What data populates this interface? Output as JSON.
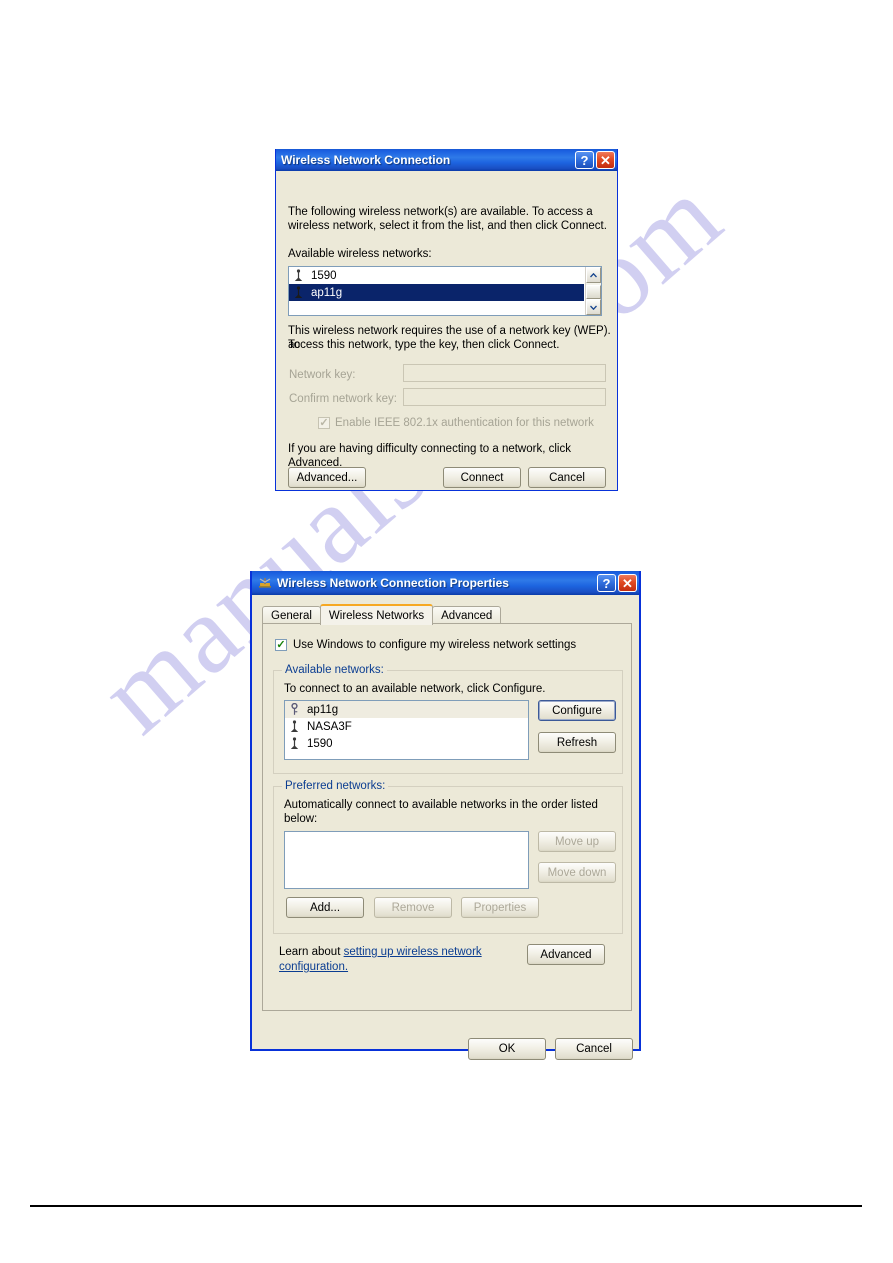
{
  "page": {
    "watermark_text": "manualsave.com"
  },
  "dialog1": {
    "title": "Wireless Network Connection",
    "titlebar": {
      "help_label": "?",
      "close_label": "✕"
    },
    "intro_line1": "The following wireless network(s) are available. To access a",
    "intro_line2": "wireless network, select it from the list, and then click Connect.",
    "available_label": "Available wireless networks:",
    "networks": [
      {
        "name": "1590",
        "icon": "tower-icon",
        "selected": false
      },
      {
        "name": "ap11g",
        "icon": "tower-icon",
        "selected": true
      }
    ],
    "wep_line1": "This wireless network requires the use of a network key (WEP). To",
    "wep_line2": "access this network, type the key, then click Connect.",
    "network_key_label": "Network key:",
    "network_key_value": "",
    "confirm_key_label": "Confirm network key:",
    "confirm_key_value": "",
    "ieee_checkbox_label": "Enable IEEE 802.1x authentication for this network",
    "ieee_checked": true,
    "difficulty_text": "If you are having difficulty connecting to a network, click Advanced.",
    "buttons": {
      "advanced": "Advanced...",
      "connect": "Connect",
      "cancel": "Cancel"
    }
  },
  "dialog2": {
    "title": "Wireless Network Connection Properties",
    "titlebar": {
      "help_label": "?",
      "close_label": "✕"
    },
    "tabs": [
      {
        "label": "General",
        "active": false
      },
      {
        "label": "Wireless Networks",
        "active": true
      },
      {
        "label": "Advanced",
        "active": false
      }
    ],
    "use_windows_label": "Use Windows to configure my wireless network settings",
    "use_windows_checked": true,
    "available_group": {
      "title": "Available networks:",
      "hint": "To connect to an available network, click Configure.",
      "networks": [
        {
          "name": "ap11g",
          "icon": "key-icon",
          "selected": true
        },
        {
          "name": "NASA3F",
          "icon": "tower-icon",
          "selected": false
        },
        {
          "name": "1590",
          "icon": "tower-icon",
          "selected": false
        }
      ],
      "configure_button": "Configure",
      "refresh_button": "Refresh"
    },
    "preferred_group": {
      "title": "Preferred networks:",
      "hint_line1": "Automatically connect to available networks in the order listed",
      "hint_line2": "below:",
      "networks": [],
      "move_up_button": "Move up",
      "move_down_button": "Move down",
      "add_button": "Add...",
      "remove_button": "Remove",
      "properties_button": "Properties"
    },
    "learn_prefix": "Learn about ",
    "learn_link_line1": "setting up wireless network",
    "learn_link_line2": "configuration.",
    "advanced_button": "Advanced",
    "ok_button": "OK",
    "cancel_button": "Cancel"
  },
  "colors": {
    "title_blue": "#1b5fe0",
    "dialog_face": "#ece9d8",
    "selection_blue": "#0a246a",
    "active_tab_orange": "#f6a822",
    "link_blue": "#0b3d91",
    "watermark_purple": "#c9c7ef"
  }
}
